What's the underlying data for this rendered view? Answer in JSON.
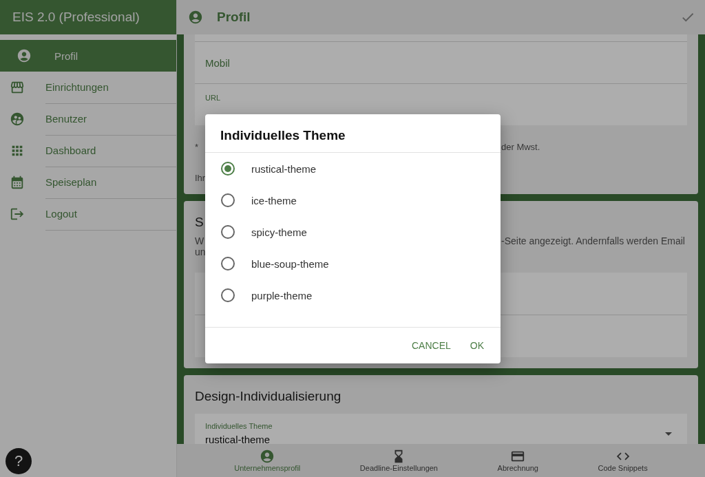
{
  "sidebar": {
    "title": "EIS 2.0 (Professional)",
    "items": [
      {
        "label": "Profil",
        "selected": true
      },
      {
        "label": "Einrichtungen",
        "selected": false
      },
      {
        "label": "Benutzer",
        "selected": false
      },
      {
        "label": "Dashboard",
        "selected": false
      },
      {
        "label": "Speiseplan",
        "selected": false
      },
      {
        "label": "Logout",
        "selected": false
      }
    ]
  },
  "help_button": {
    "label": "?"
  },
  "header": {
    "title": "Profil"
  },
  "profile_card": {
    "fields": [
      {
        "placeholder": "Mobil"
      },
      {
        "label": "URL"
      }
    ],
    "note_start": "*",
    "note_end": "der Mwst.",
    "info_start": "Ihr"
  },
  "page_card": {
    "title_start": "S",
    "description_start": "W",
    "description_end": "-Seite angezeigt. Andernfalls werden Email",
    "description_line_2": "un"
  },
  "design_card": {
    "title": "Design-Individualisierung",
    "select": {
      "label": "Individuelles Theme",
      "value": "rustical-theme"
    }
  },
  "bottom_nav": [
    {
      "label": "Unternehmensprofil",
      "selected": true
    },
    {
      "label": "Deadline-Einstellungen",
      "selected": false
    },
    {
      "label": "Abrechnung",
      "selected": false
    },
    {
      "label": "Code Snippets",
      "selected": false
    }
  ],
  "dialog": {
    "title": "Individuelles Theme",
    "options": [
      {
        "label": "rustical-theme",
        "selected": true
      },
      {
        "label": "ice-theme",
        "selected": false
      },
      {
        "label": "spicy-theme",
        "selected": false
      },
      {
        "label": "blue-soup-theme",
        "selected": false
      },
      {
        "label": "purple-theme",
        "selected": false
      }
    ],
    "buttons": [
      "CANCEL",
      "OK"
    ]
  }
}
